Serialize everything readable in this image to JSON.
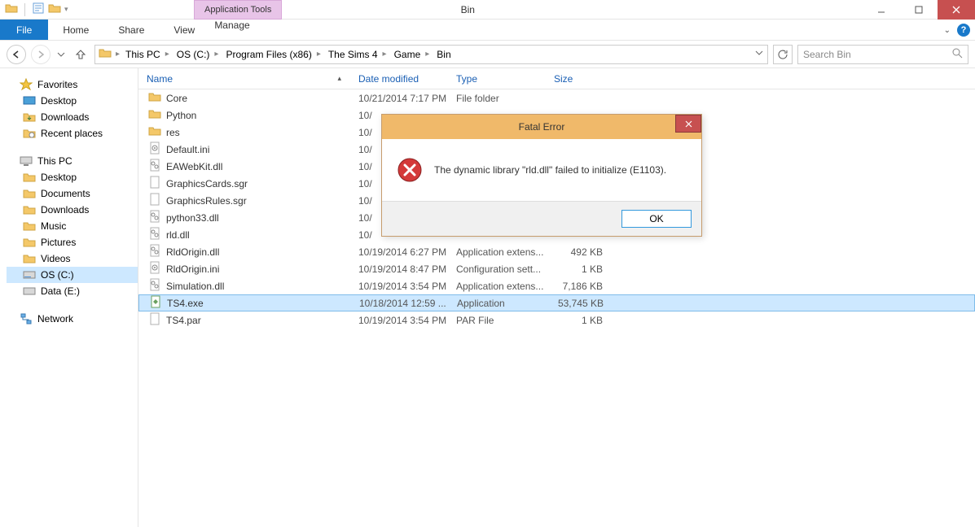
{
  "window": {
    "title": "Bin",
    "contextual_tab": "Application Tools"
  },
  "ribbon": {
    "file": "File",
    "tabs": [
      "Home",
      "Share",
      "View"
    ],
    "manage": "Manage"
  },
  "breadcrumbs": [
    "This PC",
    "OS (C:)",
    "Program Files (x86)",
    "The Sims 4",
    "Game",
    "Bin"
  ],
  "search": {
    "placeholder": "Search Bin"
  },
  "navpane": {
    "favorites": {
      "label": "Favorites",
      "items": [
        "Desktop",
        "Downloads",
        "Recent places"
      ]
    },
    "thispc": {
      "label": "This PC",
      "items": [
        "Desktop",
        "Documents",
        "Downloads",
        "Music",
        "Pictures",
        "Videos",
        "OS (C:)",
        "Data (E:)"
      ]
    },
    "network": {
      "label": "Network"
    }
  },
  "columns": {
    "name": "Name",
    "date": "Date modified",
    "type": "Type",
    "size": "Size"
  },
  "files": [
    {
      "icon": "folder",
      "name": "Core",
      "date": "10/21/2014 7:17 PM",
      "type": "File folder",
      "size": ""
    },
    {
      "icon": "folder",
      "name": "Python",
      "date": "10/",
      "type": "",
      "size": ""
    },
    {
      "icon": "folder",
      "name": "res",
      "date": "10/",
      "type": "",
      "size": ""
    },
    {
      "icon": "ini",
      "name": "Default.ini",
      "date": "10/",
      "type": "",
      "size": ""
    },
    {
      "icon": "dll",
      "name": "EAWebKit.dll",
      "date": "10/",
      "type": "",
      "size": ""
    },
    {
      "icon": "file",
      "name": "GraphicsCards.sgr",
      "date": "10/",
      "type": "",
      "size": ""
    },
    {
      "icon": "file",
      "name": "GraphicsRules.sgr",
      "date": "10/",
      "type": "",
      "size": ""
    },
    {
      "icon": "dll",
      "name": "python33.dll",
      "date": "10/",
      "type": "",
      "size": ""
    },
    {
      "icon": "dll",
      "name": "rld.dll",
      "date": "10/",
      "type": "",
      "size": ""
    },
    {
      "icon": "dll",
      "name": "RldOrigin.dll",
      "date": "10/19/2014 6:27 PM",
      "type": "Application extens...",
      "size": "492 KB"
    },
    {
      "icon": "ini",
      "name": "RldOrigin.ini",
      "date": "10/19/2014 8:47 PM",
      "type": "Configuration sett...",
      "size": "1 KB"
    },
    {
      "icon": "dll",
      "name": "Simulation.dll",
      "date": "10/19/2014 3:54 PM",
      "type": "Application extens...",
      "size": "7,186 KB"
    },
    {
      "icon": "exe",
      "name": "TS4.exe",
      "date": "10/18/2014 12:59 ...",
      "type": "Application",
      "size": "53,745 KB",
      "selected": true
    },
    {
      "icon": "file",
      "name": "TS4.par",
      "date": "10/19/2014 3:54 PM",
      "type": "PAR File",
      "size": "1 KB"
    }
  ],
  "dialog": {
    "title": "Fatal Error",
    "message": "The dynamic library \"rld.dll\" failed to initialize (E1103).",
    "ok": "OK"
  }
}
